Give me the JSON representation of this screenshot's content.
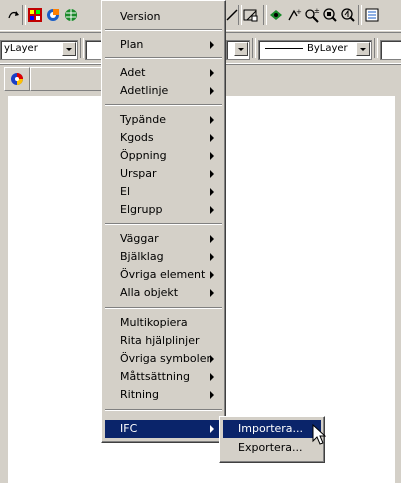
{
  "toolbar": {
    "layer_combo_value": "yLayer",
    "linetype_combo_value": "ByLayer"
  },
  "main_menu": {
    "items": [
      {
        "label": "Version",
        "submenu": false
      },
      {
        "label": "Plan",
        "submenu": true
      },
      {
        "label": "Adet",
        "submenu": true
      },
      {
        "label": "Adetlinje",
        "submenu": true
      },
      {
        "label": "Typände",
        "submenu": true
      },
      {
        "label": "Kgods",
        "submenu": true
      },
      {
        "label": "Öppning",
        "submenu": true
      },
      {
        "label": "Urspar",
        "submenu": true
      },
      {
        "label": "El",
        "submenu": true
      },
      {
        "label": "Elgrupp",
        "submenu": true
      },
      {
        "label": "Väggar",
        "submenu": true
      },
      {
        "label": "Bjälklag",
        "submenu": true
      },
      {
        "label": "Övriga element",
        "submenu": true
      },
      {
        "label": "Alla objekt",
        "submenu": true
      },
      {
        "label": "Multikopiera",
        "submenu": false
      },
      {
        "label": "Rita hjälplinjer",
        "submenu": false
      },
      {
        "label": "Övriga symboler",
        "submenu": true
      },
      {
        "label": "Måttsättning",
        "submenu": true
      },
      {
        "label": "Ritning",
        "submenu": true
      },
      {
        "label": "IFC",
        "submenu": true,
        "highlighted": true
      }
    ]
  },
  "ifc_submenu": {
    "items": [
      {
        "label": "Importera...",
        "highlighted": true
      },
      {
        "label": "Exportera..."
      }
    ]
  },
  "colors": {
    "chrome": "#d4d0c8",
    "highlight": "#0a246a",
    "canvas": "#ffffff"
  }
}
